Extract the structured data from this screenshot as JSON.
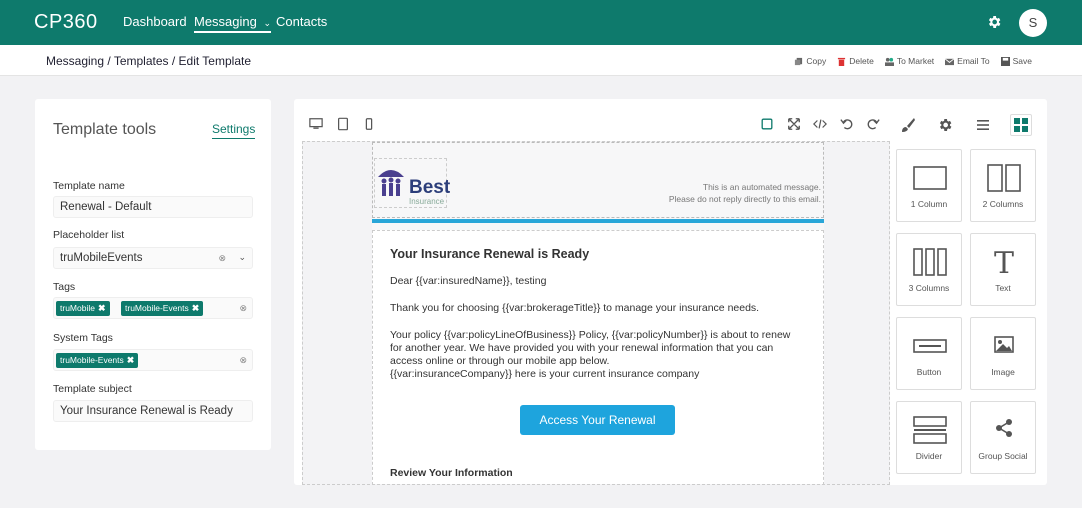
{
  "app": {
    "logo": "CP360",
    "avatar_letter": "S"
  },
  "nav": {
    "dashboard": "Dashboard",
    "messaging": "Messaging",
    "contacts": "Contacts"
  },
  "breadcrumb": "Messaging / Templates / Edit Template",
  "actions": {
    "copy": "Copy",
    "delete": "Delete",
    "to_market": "To Market",
    "email_to": "Email To",
    "save": "Save"
  },
  "left": {
    "title": "Template tools",
    "settings": "Settings",
    "template_name_label": "Template name",
    "template_name": "Renewal - Default",
    "placeholder_label": "Placeholder list",
    "placeholder_value": "truMobileEvents",
    "tags_label": "Tags",
    "tags": [
      "truMobile",
      "truMobile-Events"
    ],
    "system_tags_label": "System Tags",
    "system_tags": [
      "truMobile-Events"
    ],
    "subject_label": "Template subject",
    "subject": "Your Insurance Renewal is Ready"
  },
  "email": {
    "logo_word": "Best",
    "logo_sub": "Insurance",
    "auto_msg_1": "This is an automated message.",
    "auto_msg_2": "Please do not reply directly to this email.",
    "title": "Your Insurance Renewal is Ready",
    "dear": "Dear {{var:insuredName}}, testing",
    "thanks": "Thank you for choosing {{var:brokerageTitle}} to manage your insurance needs.",
    "policy_1": "Your policy {{var:policyLineOfBusiness}} Policy, {{var:policyNumber}} is about to renew",
    "policy_2": "for another year.  We have provided you with your renewal information that you can",
    "policy_3": "access online or through our mobile app below.",
    "policy_4": "{{var:insuranceCompany}} here is your current insurance company",
    "cta": "Access Your Renewal",
    "review": "Review Your Information"
  },
  "blocks": [
    "1 Column",
    "2 Columns",
    "3 Columns",
    "Text",
    "Button",
    "Image",
    "Divider",
    "Group Social"
  ],
  "colors": {
    "brand": "#0e7a6c",
    "cta": "#1ea4dd"
  }
}
